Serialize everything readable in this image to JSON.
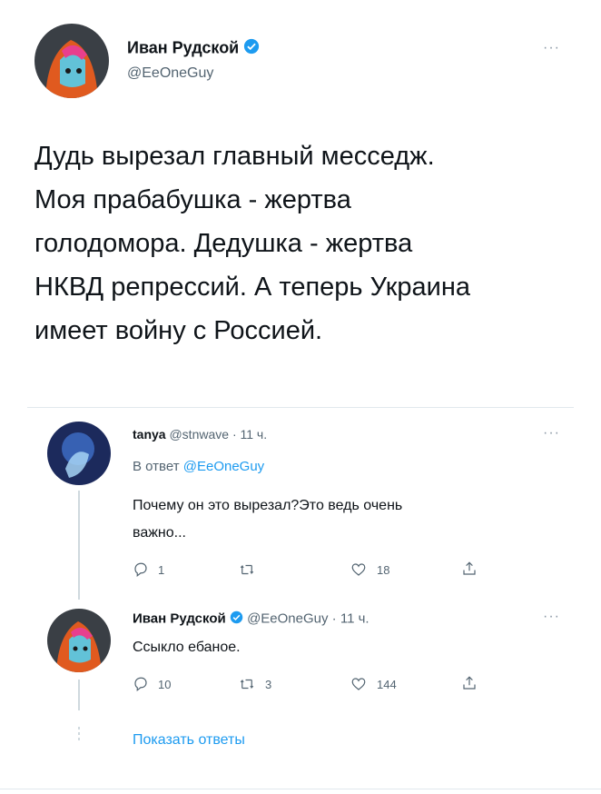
{
  "main_tweet": {
    "author_name": "Иван Рудской",
    "handle": "@EeOneGuy",
    "text_lines": [
      "Дудь вырезал главный месседж.",
      "Моя прабабушка - жертва",
      "голодомора. Дедушка - жертва",
      "НКВД репрессий. А теперь Украина",
      "имеет войну с Россией."
    ]
  },
  "reply1": {
    "author_name": "tanya",
    "handle": "@stnwave",
    "time": "· 11 ч.",
    "in_reply_prefix": "В ответ",
    "in_reply_handle": "@EeOneGuy",
    "text_lines": [
      "Почему он это вырезал?Это ведь очень",
      "важно..."
    ],
    "actions": {
      "reply": "1",
      "retweet": "",
      "like": "18"
    }
  },
  "reply2": {
    "author_name": "Иван Рудской",
    "handle": "@EeOneGuy",
    "time": "· 11 ч.",
    "text": "Ссыкло ебаное.",
    "actions": {
      "reply": "10",
      "retweet": "3",
      "like": "144"
    }
  },
  "show_replies": "Показать ответы",
  "colors": {
    "accent": "#1d9bf0",
    "verified": "#1d9bf0",
    "text": "#0f1419",
    "muted": "#536471"
  }
}
